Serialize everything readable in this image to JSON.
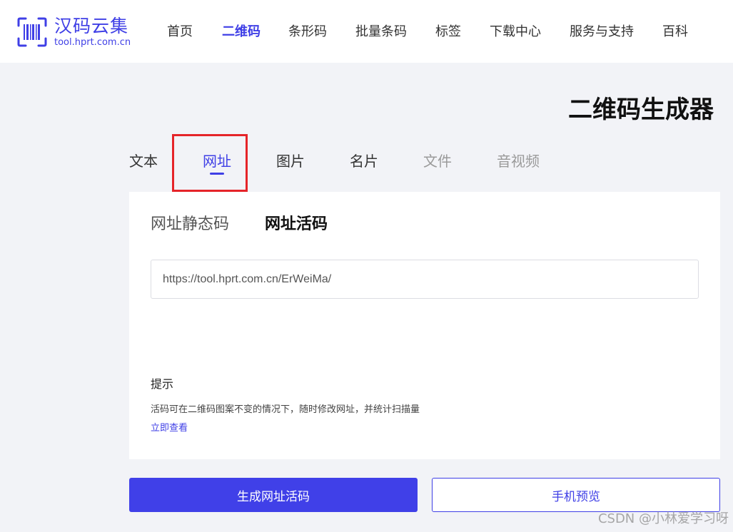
{
  "header": {
    "logo": {
      "title": "汉码云集",
      "subtitle": "tool.hprt.com.cn"
    },
    "nav": [
      {
        "label": "首页",
        "active": false
      },
      {
        "label": "二维码",
        "active": true
      },
      {
        "label": "条形码",
        "active": false
      },
      {
        "label": "批量条码",
        "active": false
      },
      {
        "label": "标签",
        "active": false
      },
      {
        "label": "下载中心",
        "active": false
      },
      {
        "label": "服务与支持",
        "active": false
      },
      {
        "label": "百科",
        "active": false
      }
    ]
  },
  "page_title": "二维码生成器",
  "category_tabs": [
    {
      "label": "文本",
      "state": "normal"
    },
    {
      "label": "网址",
      "state": "active"
    },
    {
      "label": "图片",
      "state": "normal"
    },
    {
      "label": "名片",
      "state": "normal"
    },
    {
      "label": "文件",
      "state": "muted"
    },
    {
      "label": "音视频",
      "state": "muted"
    }
  ],
  "card": {
    "sub_tabs": [
      {
        "label": "网址静态码",
        "active": false
      },
      {
        "label": "网址活码",
        "active": true
      }
    ],
    "url_input": {
      "value": "https://tool.hprt.com.cn/ErWeiMa/"
    },
    "tip": {
      "title": "提示",
      "text": "活码可在二维码图案不变的情况下，随时修改网址，并统计扫描量",
      "link": "立即查看"
    }
  },
  "actions": {
    "generate": "生成网址活码",
    "preview": "手机预览"
  },
  "watermark": "CSDN @小林爱学习呀",
  "colors": {
    "accent": "#3f3fe6",
    "highlight_border": "#e52429",
    "page_background": "#f2f3f7"
  }
}
